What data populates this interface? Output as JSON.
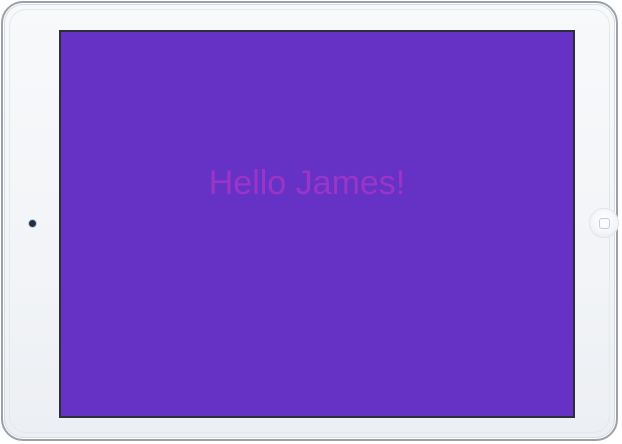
{
  "screen": {
    "greeting": "Hello James!",
    "background_color": "#6631c5",
    "text_color": "#9a35c8"
  },
  "device": {
    "frame_color": "#f4f6f9",
    "home_button_icon": "home-square-icon",
    "camera_icon": "camera-dot-icon"
  }
}
